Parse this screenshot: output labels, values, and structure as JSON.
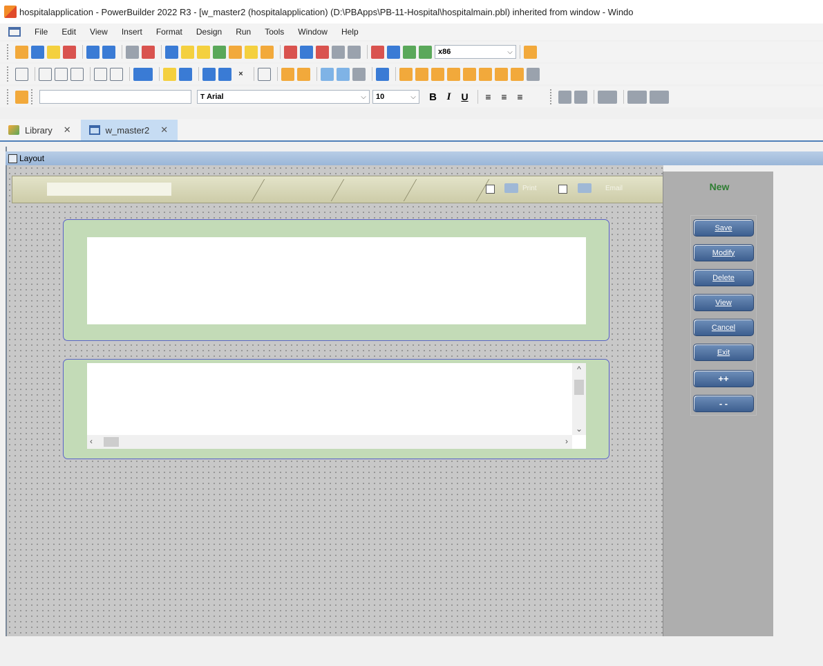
{
  "window": {
    "title": "hospitalapplication - PowerBuilder 2022 R3 - [w_master2 (hospitalapplication) (D:\\PBApps\\PB-11-Hospital\\hospitalmain.pbl) inherited from window - Windo"
  },
  "menu": [
    "File",
    "Edit",
    "View",
    "Insert",
    "Format",
    "Design",
    "Run",
    "Tools",
    "Window",
    "Help"
  ],
  "toolbar1": {
    "platform": "x86"
  },
  "toolbar3": {
    "font": "Arial",
    "size": "10",
    "bold": "B",
    "italic": "I",
    "underline": "U"
  },
  "tabs": [
    {
      "label": "Library",
      "close": "✕"
    },
    {
      "label": "w_master2",
      "close": "✕"
    }
  ],
  "layout": {
    "title": "Layout"
  },
  "canvas": {
    "header": {
      "print_label": "Print",
      "email_label": "Email"
    },
    "side": {
      "new_label": "New",
      "buttons": [
        "Save",
        "Modify",
        "Delete",
        "View",
        "Cancel",
        "Exit",
        "++",
        "- -"
      ]
    }
  },
  "colors": {
    "tab_active": "#c6dcf3",
    "layout_bar": "#b8cde6",
    "group_fill": "#c3dbb7",
    "group_border": "#5a62c8",
    "button_fill": "#4f6f9f",
    "new_label": "#2e7d32"
  }
}
